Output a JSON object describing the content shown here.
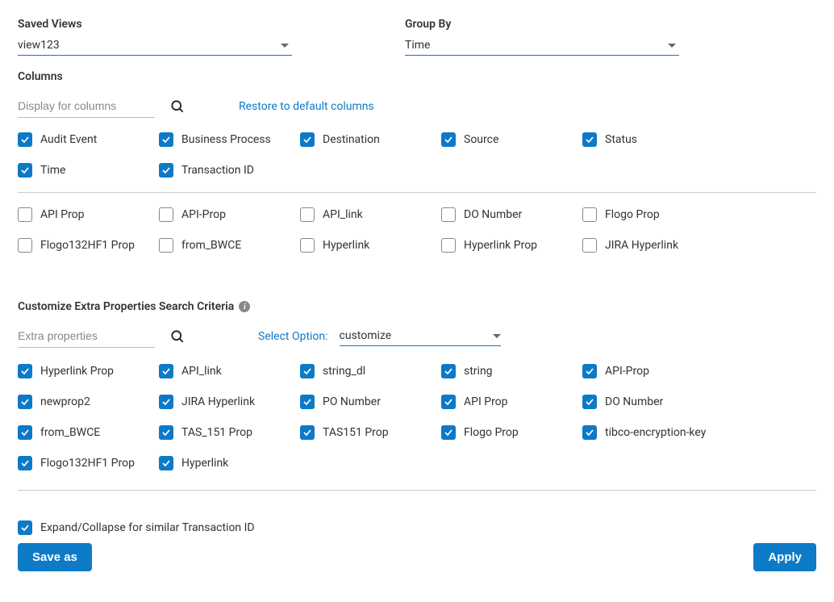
{
  "savedViews": {
    "label": "Saved Views",
    "value": "view123"
  },
  "groupBy": {
    "label": "Group By",
    "value": "Time"
  },
  "columns": {
    "label": "Columns",
    "searchPlaceholder": "Display for columns",
    "restoreLink": "Restore to default columns",
    "checked": [
      "Audit Event",
      "Business Process",
      "Destination",
      "Source",
      "Status",
      "Time",
      "Transaction ID"
    ],
    "unchecked": [
      "API Prop",
      "API-Prop",
      "API_link",
      "DO Number",
      "Flogo Prop",
      "Flogo132HF1 Prop",
      "from_BWCE",
      "Hyperlink",
      "Hyperlink Prop",
      "JIRA Hyperlink"
    ]
  },
  "customize": {
    "label": "Customize Extra Properties Search Criteria",
    "searchPlaceholder": "Extra properties",
    "selectOptionLabel": "Select Option:",
    "selectOptionValue": "customize",
    "checked": [
      "Hyperlink Prop",
      "API_link",
      "string_dl",
      "string",
      "API-Prop",
      "newprop2",
      "JIRA Hyperlink",
      "PO Number",
      "API Prop",
      "DO Number",
      "from_BWCE",
      "TAS_151 Prop",
      "TAS151 Prop",
      "Flogo Prop",
      "tibco-encryption-key",
      "Flogo132HF1 Prop",
      "Hyperlink"
    ]
  },
  "expandCollapse": {
    "label": "Expand/Collapse for similar Transaction ID",
    "checked": true
  },
  "buttons": {
    "saveAs": "Save as",
    "apply": "Apply"
  }
}
